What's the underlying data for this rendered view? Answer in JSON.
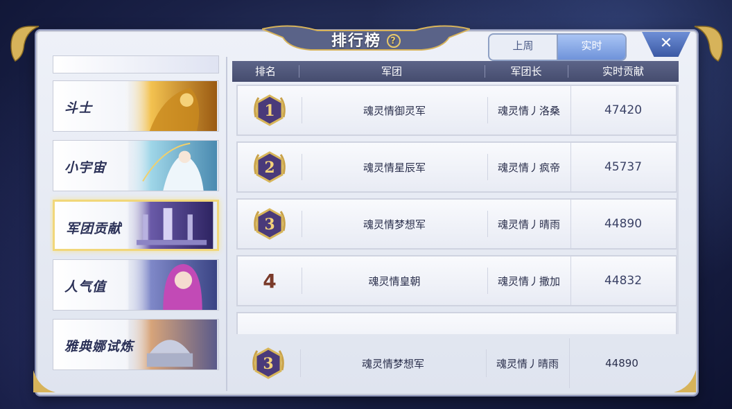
{
  "title": "排行榜",
  "help_icon": "question-circle-icon",
  "tabs": [
    {
      "label": "上周",
      "active": false
    },
    {
      "label": "实时",
      "active": true
    }
  ],
  "close_icon": "close-x-icon",
  "sidebar": {
    "items": [
      {
        "label": "斗士",
        "active": false
      },
      {
        "label": "小宇宙",
        "active": false
      },
      {
        "label": "军团贡献",
        "active": true
      },
      {
        "label": "人气值",
        "active": false
      },
      {
        "label": "雅典娜试炼",
        "active": false
      }
    ]
  },
  "table": {
    "headers": [
      "排名",
      "军团",
      "军团长",
      "实时贡献"
    ],
    "rows": [
      {
        "rank": "1",
        "legion": "魂灵情御灵军",
        "leader": "魂灵情丿洛桑",
        "contribution": "47420"
      },
      {
        "rank": "2",
        "legion": "魂灵情星辰军",
        "leader": "魂灵情丿疯帝",
        "contribution": "45737"
      },
      {
        "rank": "3",
        "legion": "魂灵情梦想军",
        "leader": "魂灵情丿晴雨",
        "contribution": "44890"
      },
      {
        "rank": "4",
        "legion": "魂灵情皇朝",
        "leader": "魂灵情丿撒加",
        "contribution": "44832"
      }
    ],
    "my_row": {
      "rank": "3",
      "legion": "魂灵情梦想军",
      "leader": "魂灵情丿晴雨",
      "contribution": "44890"
    }
  },
  "colors": {
    "accent_gold": "#e8c96a",
    "badge_purple": "#4a3a7a",
    "header_bg": "#4f5779"
  }
}
